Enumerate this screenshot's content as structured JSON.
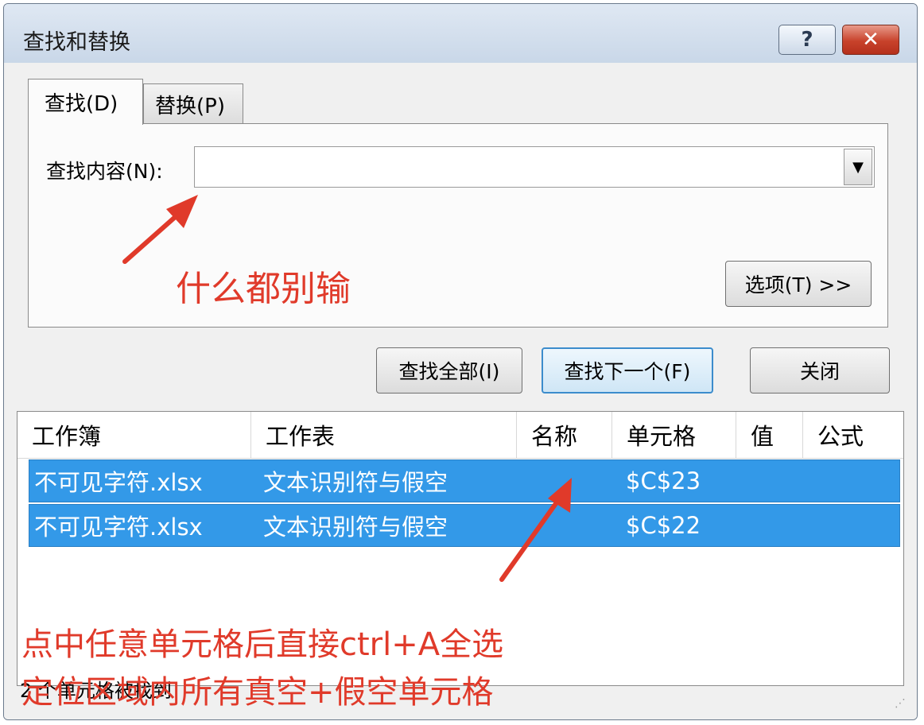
{
  "dialog": {
    "title": "查找和替换",
    "help_label": "?",
    "close_label": "✕"
  },
  "tabs": [
    {
      "label": "查找(D)",
      "active": true
    },
    {
      "label": "替换(P)",
      "active": false
    }
  ],
  "find": {
    "label": "查找内容(N):",
    "value": "",
    "dropdown_icon": "▼"
  },
  "buttons": {
    "options": "选项(T) >>",
    "find_all": "查找全部(I)",
    "find_next": "查找下一个(F)",
    "close": "关闭"
  },
  "results": {
    "columns": [
      "工作簿",
      "工作表",
      "名称",
      "单元格",
      "值",
      "公式"
    ],
    "rows": [
      {
        "workbook": "不可见字符.xlsx",
        "sheet": "文本识别符与假空",
        "name": "",
        "cell": "$C$23",
        "value": "",
        "formula": ""
      },
      {
        "workbook": "不可见字符.xlsx",
        "sheet": "文本识别符与假空",
        "name": "",
        "cell": "$C$22",
        "value": "",
        "formula": ""
      }
    ],
    "selected_color": "#3399e8"
  },
  "status_text": "2 个单元格被找到",
  "annotations": {
    "top": "什么都别输",
    "bottom_line1": "点中任意单元格后直接ctrl+A全选",
    "bottom_line2": "定位区域内所有真空+假空单元格",
    "color": "#e03a2a"
  }
}
